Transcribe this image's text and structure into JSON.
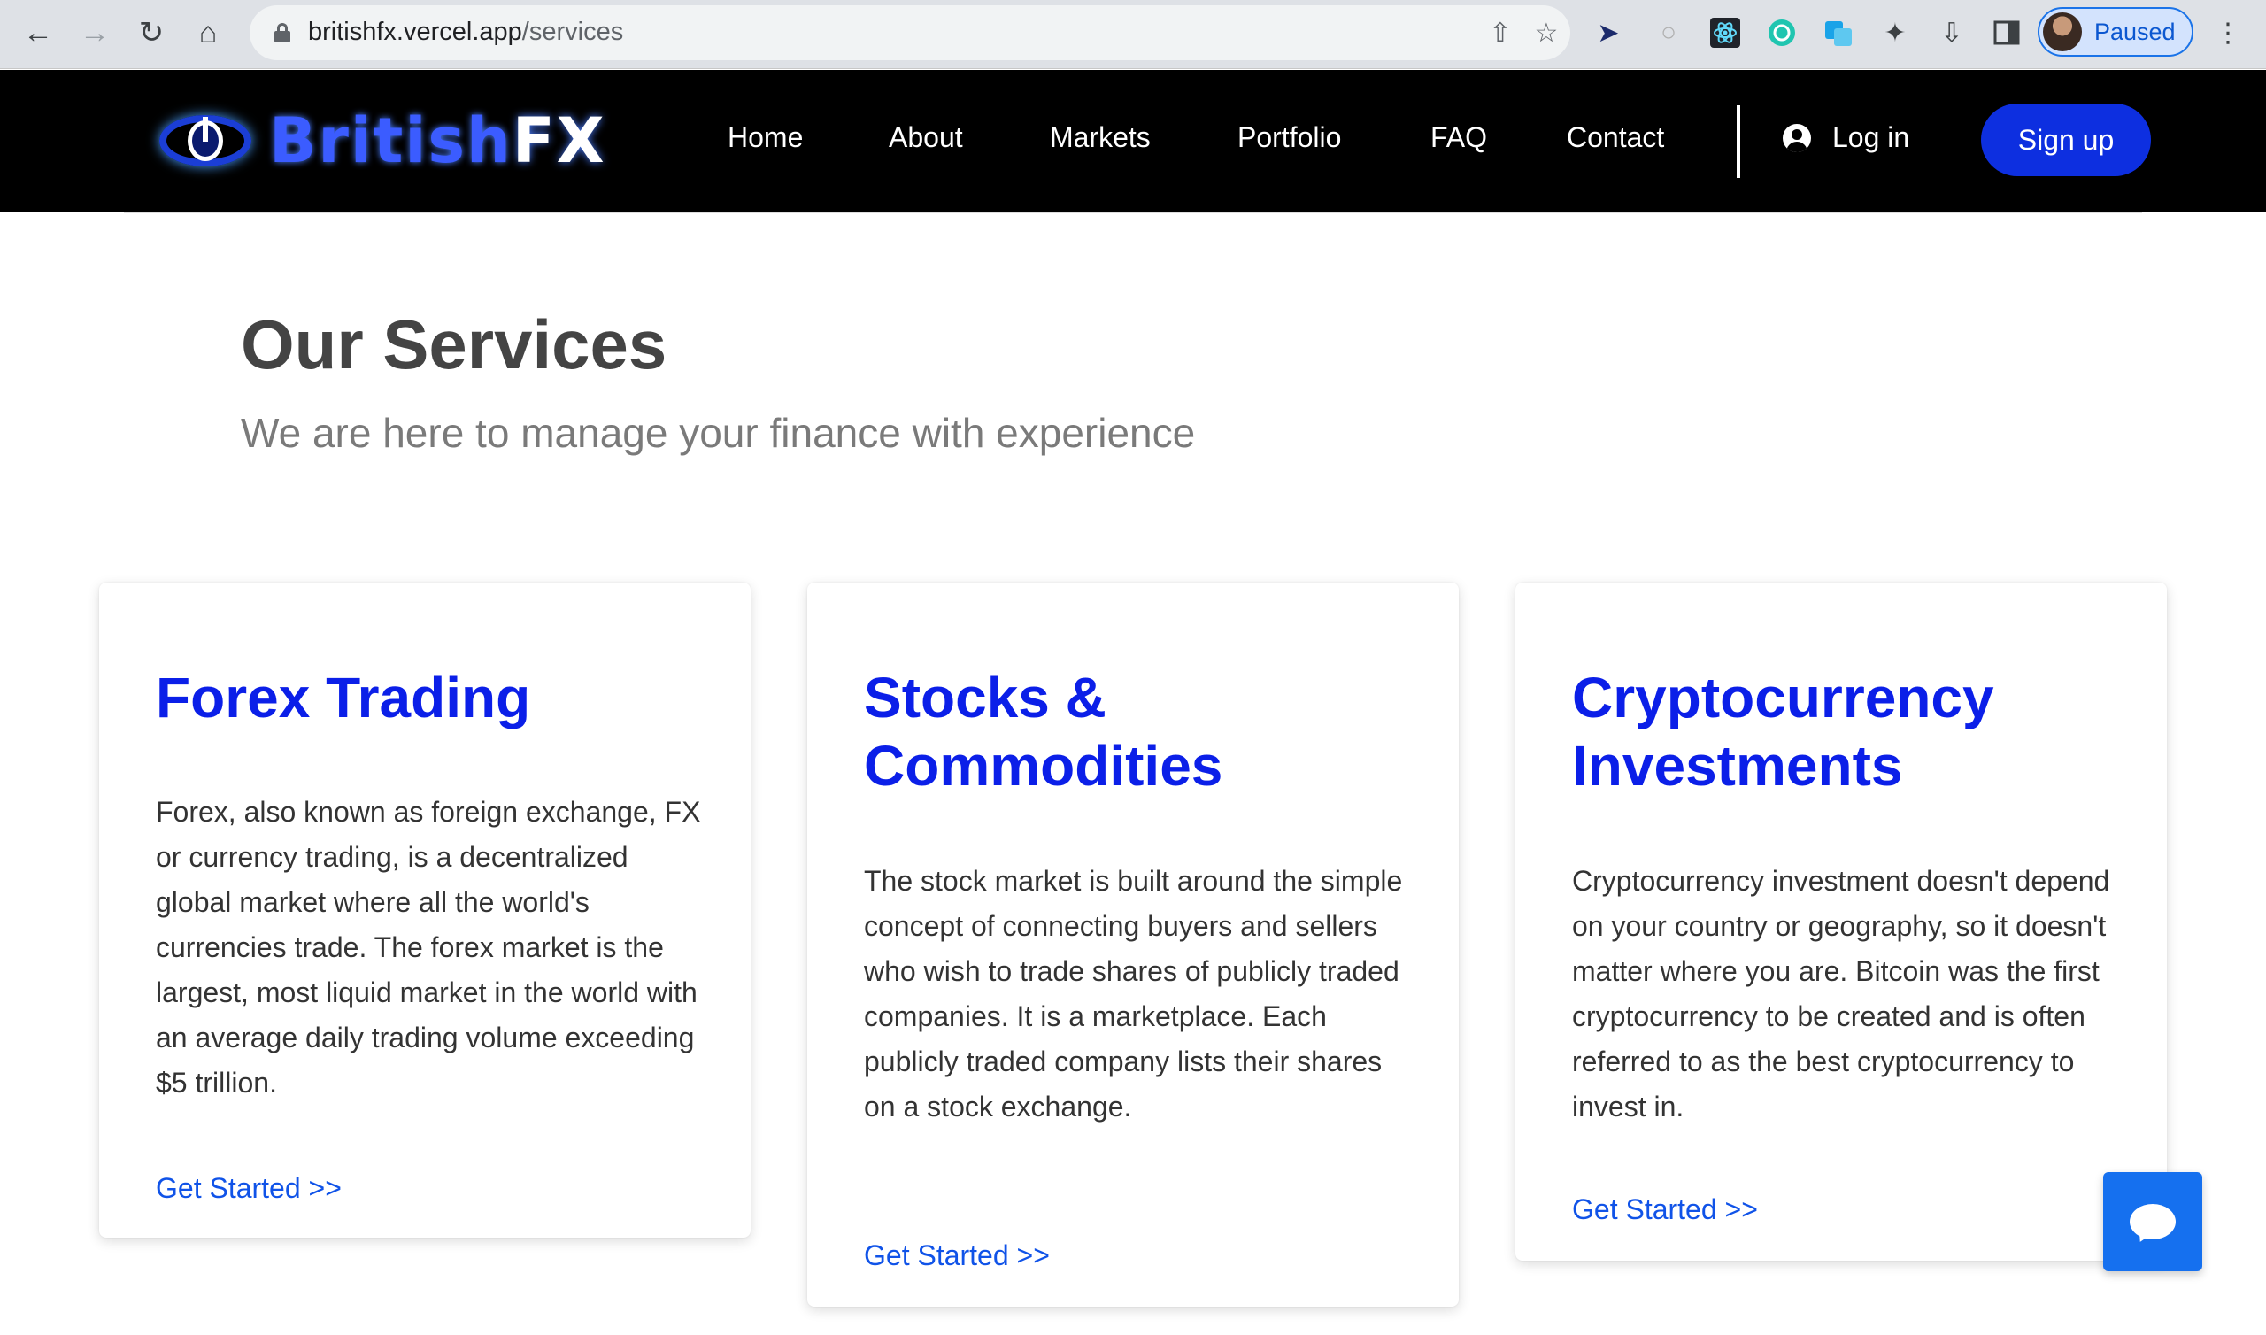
{
  "browser": {
    "url_host": "britishfx.vercel.app",
    "url_path": "/services",
    "profile_label": "Paused",
    "icons": [
      "back-icon",
      "forward-icon",
      "reload-icon",
      "home-icon",
      "share-icon",
      "star-icon",
      "cursor-extension-icon",
      "circle-extension-icon",
      "react-devtools-icon",
      "chatgpt-extension-icon",
      "translate-extension-icon",
      "extensions-puzzle-icon",
      "download-icon",
      "sidepanel-icon",
      "kebab-menu-icon"
    ]
  },
  "header": {
    "logo_text_part1": "British",
    "logo_text_part2": "FX",
    "nav": [
      "Home",
      "About",
      "Markets",
      "Portfolio",
      "FAQ",
      "Contact"
    ],
    "login_label": "Log in",
    "signup_label": "Sign up"
  },
  "services": {
    "title": "Our Services",
    "subtitle": "We are here to manage your finance with experience",
    "cards": [
      {
        "title": "Forex Trading",
        "text": "Forex, also known as foreign exchange, FX or currency trading, is a decentralized global market where all the world's currencies trade. The forex market is the largest, most liquid market in the world with an average daily trading volume exceeding $5 trillion.",
        "link": "Get Started >>"
      },
      {
        "title": "Stocks & Commodities",
        "text": "The stock market is built around the simple concept of connecting buyers and sellers who wish to trade shares of publicly traded companies. It is a marketplace. Each publicly traded company lists their shares on a stock exchange.",
        "link": "Get Started >>"
      },
      {
        "title": "Cryptocurrency Investments",
        "text": "Cryptocurrency investment doesn't depend on your country or geography, so it doesn't matter where you are. Bitcoin was the first cryptocurrency to be created and is often referred to as the best cryptocurrency to invest in.",
        "link": "Get Started >>"
      }
    ]
  },
  "colors": {
    "header_bg": "#000000",
    "accent_blue": "#0b1fe8",
    "signup_bg": "#0d2fe0",
    "link_blue": "#1053e8",
    "chat_bg": "#1570ef"
  }
}
